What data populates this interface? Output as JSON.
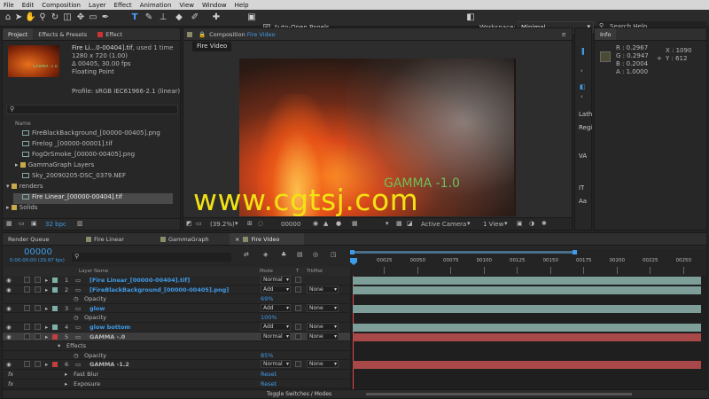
{
  "menu": [
    "File",
    "Edit",
    "Composition",
    "Layer",
    "Effect",
    "Animation",
    "View",
    "Window",
    "Help"
  ],
  "toolbar": {
    "auto_open": "Auto-Open Panels",
    "workspace_label": "Workspace:",
    "workspace_value": "Minimal",
    "search_placeholder": "Search Help"
  },
  "project": {
    "tabs": [
      "Project",
      "Effects & Presets",
      "Effect"
    ],
    "thumb_text": "GAMMA -1.0",
    "item_name": "Fire Li...0-00404].tif",
    "item_used": ", used 1 time",
    "item_res": "1280 x 720 (1.00)",
    "item_dur": "Δ 00405, 30.00 fps",
    "item_depth": "Floating Point",
    "profile": "Profile: sRGB IEC61966-2.1 (linear)",
    "col_name": "Name",
    "items": [
      "FireBlackBackground_[00000-00405].png",
      "Firelog _[00000-00001].tif",
      "FogOrSmoke_[00000-00405].png",
      "GammaGraph Layers",
      "Sky_20090205-DSC_0379.NEF",
      "renders",
      "Fire Linear_[00000-00404].tif",
      "Solids"
    ],
    "bpc": "32 bpc"
  },
  "comp": {
    "header": "Composition",
    "header_name": "Fire Video",
    "tab": "Fire Video",
    "overlay": "GAMMA -1.0",
    "zoom": "(39.2%)",
    "timecode": "00000",
    "camera": "Active Camera",
    "view": "1 View"
  },
  "info": {
    "title": "Info",
    "r": "R : 0.2967",
    "g": "G : 0.2947",
    "b": "B : 0.2004",
    "a": "A : 1.0000",
    "x": "X : 1090",
    "y": "Y : 612",
    "side": [
      "Lath",
      "Regi",
      "",
      "VA",
      "",
      "IT",
      "Aa"
    ]
  },
  "watermark": "www.cgtsj.com",
  "timeline": {
    "tabs": [
      "Render Queue",
      "Fire Linear",
      "GammaGraph",
      "Fire Video"
    ],
    "timecode": "00000",
    "fps": "0:00:00:00 (29.97 fps)",
    "cols": {
      "layer": "Layer Name",
      "mode": "Mode",
      "t": "T",
      "trk": "TrkMat"
    },
    "ruler": [
      "00025",
      "00050",
      "00075",
      "00100",
      "00125",
      "00150",
      "00175",
      "00200",
      "00225",
      "00250"
    ],
    "rows": [
      {
        "num": "1",
        "name": "[Fire Linear_[00000-00404].tif]",
        "mode": "Normal",
        "trk": "",
        "color": "#7fb0a8",
        "blue": true
      },
      {
        "num": "2",
        "name": "[FireBlackBackground_[00000-00405].png]",
        "mode": "Add",
        "trk": "None",
        "color": "#7fb0a8",
        "blue": true
      },
      {
        "prop": "Opacity",
        "val": "69%"
      },
      {
        "num": "3",
        "name": "glow",
        "mode": "Add",
        "trk": "None",
        "color": "#7fb0a8",
        "blue": true
      },
      {
        "prop": "Opacity",
        "val": "100%"
      },
      {
        "num": "4",
        "name": "glow bottom",
        "mode": "Add",
        "trk": "None",
        "color": "#7fb0a8",
        "blue": true
      },
      {
        "num": "5",
        "name": "GAMMA -.0",
        "mode": "Normal",
        "trk": "None",
        "color": "#c04040",
        "blue": false,
        "sel": true
      },
      {
        "sub": "Effects"
      },
      {
        "prop": "Opacity",
        "val": "85%"
      },
      {
        "num": "6",
        "name": "GAMMA -1.2",
        "mode": "Normal",
        "trk": "None",
        "color": "#c04040",
        "blue": false
      },
      {
        "fx": "Fast Blur",
        "val": "Reset"
      },
      {
        "fx": "Exposure",
        "val": "Reset"
      }
    ],
    "toggle": "Toggle Switches / Modes"
  }
}
